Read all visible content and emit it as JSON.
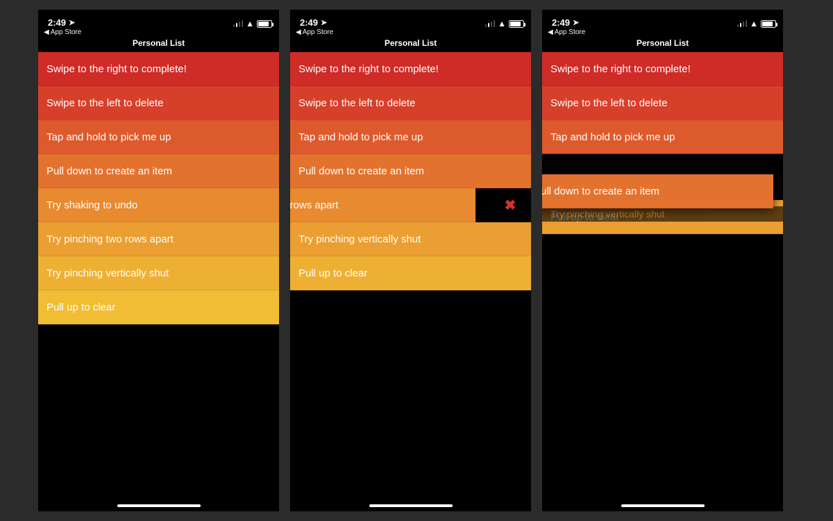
{
  "status": {
    "time": "2:49",
    "back_label": "App Store"
  },
  "header": {
    "title": "Personal List"
  },
  "items": {
    "swipe_right": "Swipe to the right to complete!",
    "swipe_left": "Swipe to the left to delete",
    "tap_hold": "Tap and hold to pick me up",
    "pull_down": "Pull down to create an item",
    "shake": "Try shaking to undo",
    "pinch_apart": "Try pinching two rows apart",
    "pinch_shut": "Try pinching vertically shut",
    "pull_up": "Pull up to clear"
  },
  "phone2": {
    "pinch_apart_partial": "ching two rows apart"
  },
  "phone3": {
    "pull_down_partial": "ull down to create an item",
    "pinch_shut_ghost": "Try pinching vertically shut"
  },
  "colors": {
    "c0": "#cf2b27",
    "c1": "#d6402a",
    "c2": "#dd5a2c",
    "c3": "#e3722e",
    "c4": "#e88a30",
    "c5": "#eb9e31",
    "c6": "#eeb033",
    "c7": "#f0bd34",
    "delete": "#d7302b"
  }
}
